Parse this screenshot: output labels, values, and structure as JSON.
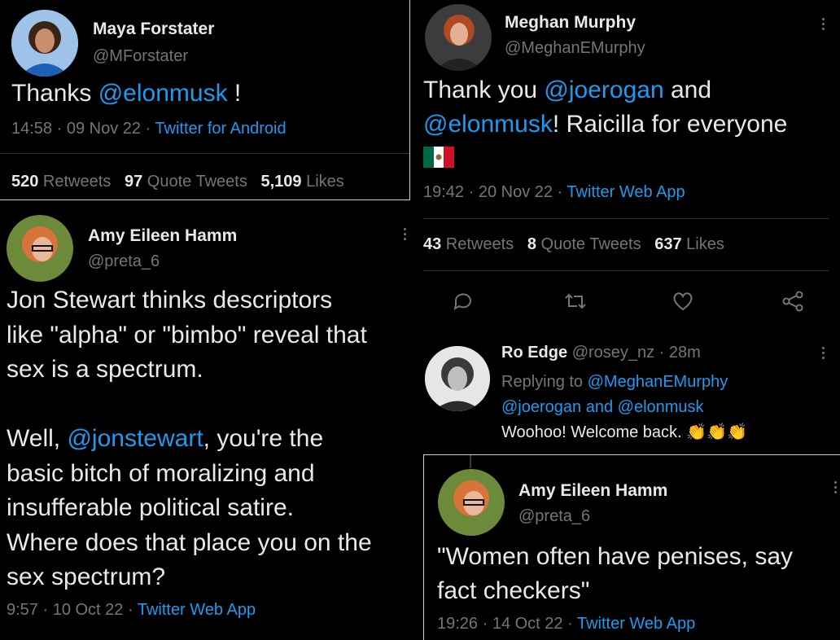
{
  "maya": {
    "name": "Maya Forstater",
    "handle": "@MForstater",
    "text_pre": "Thanks ",
    "mention": "@elonmusk",
    "text_post": " !",
    "time": "14:58 · 09 Nov 22 · ",
    "source": "Twitter for Android",
    "retweets_count": "520",
    "retweets_label": " Retweets",
    "quotes_count": "97",
    "quotes_label": " Quote Tweets",
    "likes_count": "5,109",
    "likes_label": " Likes"
  },
  "meghan": {
    "name": "Meghan Murphy",
    "handle": "@MeghanEMurphy",
    "line1_pre": "Thank you ",
    "line1_mention": "@joerogan",
    "line1_post": " and",
    "line2_mention": "@elonmusk",
    "line2_post": "! Raicilla for everyone",
    "flag": "🇲🇽",
    "time": "19:42 · 20 Nov 22 · ",
    "source": "Twitter Web App",
    "retweets_count": "43",
    "retweets_label": " Retweets",
    "quotes_count": "8",
    "quotes_label": " Quote Tweets",
    "likes_count": "637",
    "likes_label": " Likes"
  },
  "amy1": {
    "name": "Amy Eileen Hamm",
    "handle": "@preta_6",
    "lines": [
      "Jon Stewart thinks descriptors",
      "like \"alpha\" or \"bimbo\" reveal that",
      "sex is a spectrum."
    ],
    "p2_pre": "Well, ",
    "p2_mention": "@jonstewart",
    "p2_post": ", you're the",
    "p2_lines": [
      "basic bitch of moralizing and",
      "insufferable political satire.",
      "Where does that place you on the",
      "sex spectrum?"
    ],
    "time": "9:57 · 10 Oct 22 · ",
    "source": "Twitter Web App"
  },
  "ro": {
    "name": "Ro Edge",
    "handle": "@rosey_nz · 28m",
    "replying_label": "Replying to ",
    "replying_1": "@MeghanEMurphy",
    "replying_2": "@joerogan",
    "replying_and": " and ",
    "replying_3": "@elonmusk",
    "text": "Woohoo!  Welcome back. ",
    "emoji": "👏👏👏"
  },
  "amy2": {
    "name": "Amy Eileen Hamm",
    "handle": "@preta_6",
    "lines": [
      "\"Women often have penises, say",
      "fact checkers\""
    ],
    "time": "19:26 · 14 Oct 22 · ",
    "source": "Twitter Web App"
  },
  "colors": {
    "link": "#1d9bf0",
    "muted": "#71767b",
    "text": "#e7e9ea",
    "bg": "#000000"
  }
}
